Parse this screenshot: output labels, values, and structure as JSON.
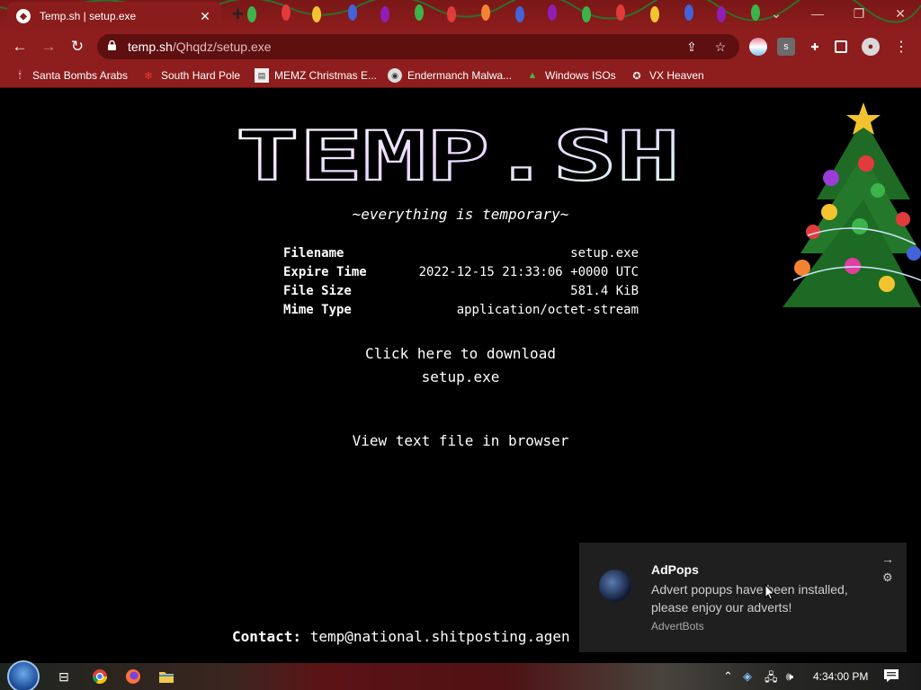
{
  "browser": {
    "tab_title": "Temp.sh | setup.exe",
    "url_host": "temp.sh",
    "url_path": "/Qhqdz/setup.exe",
    "theme_color": "#8e1d1d"
  },
  "bookmarks": [
    {
      "label": "Santa Bombs Arabs",
      "icon": "santa-icon"
    },
    {
      "label": "South Hard Pole",
      "icon": "snowflake-icon"
    },
    {
      "label": "MEMZ Christmas E...",
      "icon": "memz-icon"
    },
    {
      "label": "Endermanch Malwa...",
      "icon": "raccoon-icon"
    },
    {
      "label": "Windows ISOs",
      "icon": "tree-icon"
    },
    {
      "label": "VX Heaven",
      "icon": "vx-icon"
    }
  ],
  "page": {
    "logo_text": "TEMP.SH",
    "tagline": "~everything is temporary~",
    "file_info": [
      {
        "label": "Filename",
        "value": "setup.exe"
      },
      {
        "label": "Expire Time",
        "value": "2022-12-15 21:33:06 +0000 UTC"
      },
      {
        "label": "File Size",
        "value": "581.4 KiB"
      },
      {
        "label": "Mime Type",
        "value": "application/octet-stream"
      }
    ],
    "download_line1": "Click here to download",
    "download_line2": "setup.exe",
    "view_text": "View text file in browser",
    "contact_label": "Contact:",
    "contact_value": "temp@national.shitposting.agen"
  },
  "notification": {
    "title": "AdPops",
    "body": "Advert popups have been installed, please enjoy our adverts!",
    "source": "AdvertBots"
  },
  "taskbar": {
    "clock": "4:34:00 PM"
  }
}
